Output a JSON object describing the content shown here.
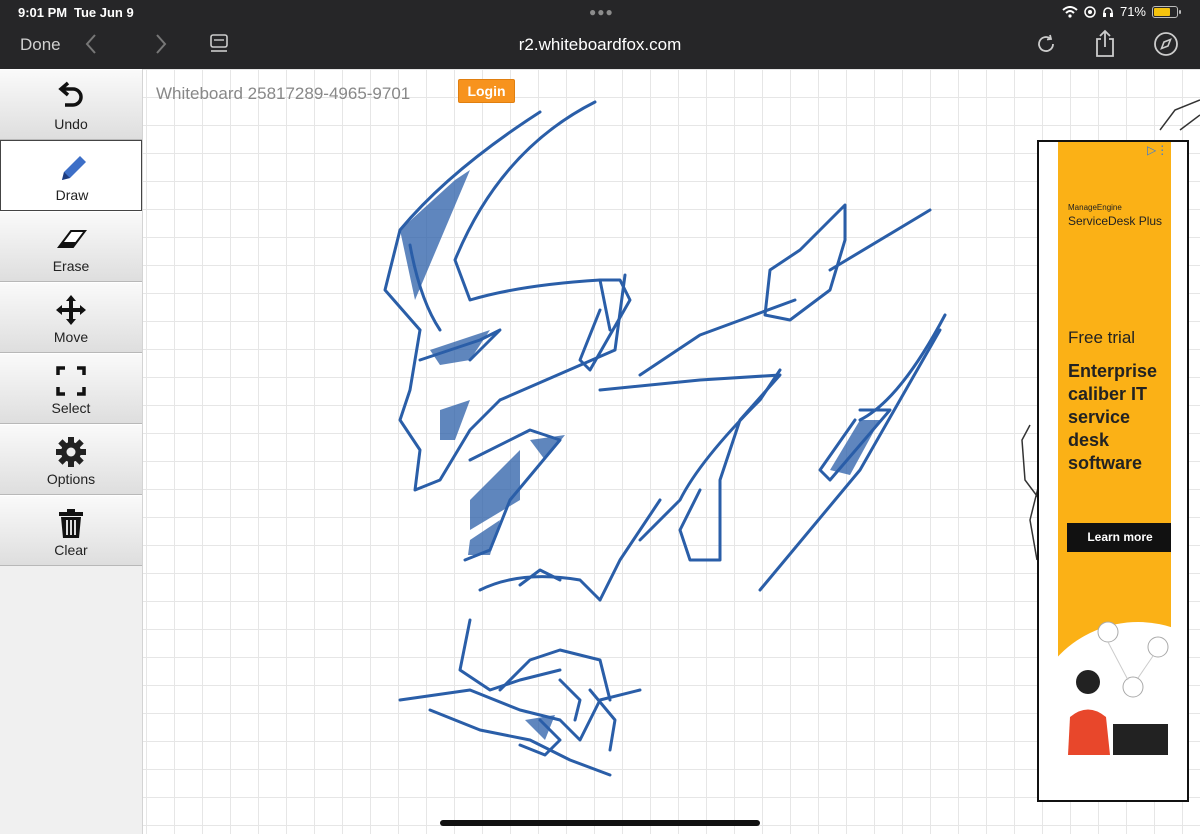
{
  "status_bar": {
    "time": "9:01 PM",
    "date": "Tue Jun 9",
    "battery": "71%",
    "battery_level": 0.71
  },
  "browser": {
    "done_label": "Done",
    "url": "r2.whiteboardfox.com",
    "icons": [
      "back-icon",
      "forward-icon",
      "reader-icon",
      "reload-icon",
      "share-icon",
      "compass-icon"
    ]
  },
  "whiteboard": {
    "title": "Whiteboard 25817289-4965-9701",
    "login_label": "Login",
    "accent": "#f7931e",
    "stroke_color": "#2a5ea8"
  },
  "tools": [
    {
      "label": "Undo",
      "icon": "undo-icon",
      "active": false
    },
    {
      "label": "Draw",
      "icon": "pencil-icon",
      "active": true
    },
    {
      "label": "Erase",
      "icon": "eraser-icon",
      "active": false
    },
    {
      "label": "Move",
      "icon": "move-icon",
      "active": false
    },
    {
      "label": "Select",
      "icon": "select-icon",
      "active": false
    },
    {
      "label": "Options",
      "icon": "gear-icon",
      "active": false
    },
    {
      "label": "Clear",
      "icon": "trash-icon",
      "active": false
    }
  ],
  "ad": {
    "brand_small": "ManageEngine",
    "brand": "ServiceDesk Plus",
    "free_trial": "Free trial",
    "headline": "Enterprise caliber IT service desk software",
    "cta": "Learn more",
    "background": "#fbb116"
  }
}
